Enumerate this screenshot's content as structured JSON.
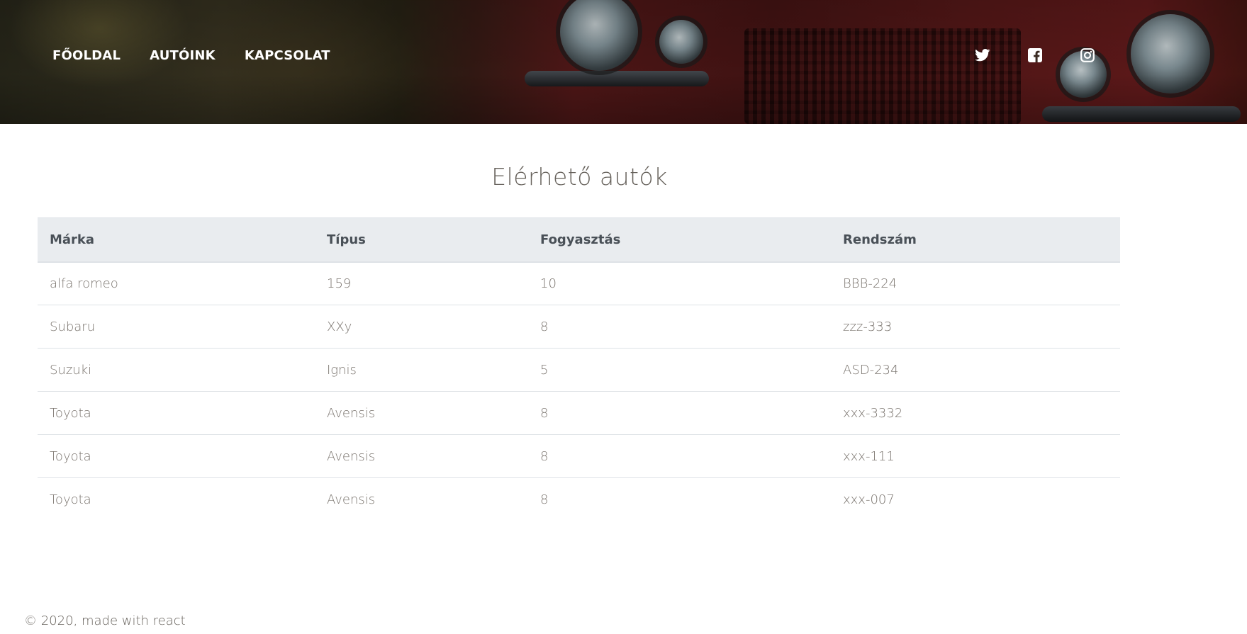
{
  "nav": {
    "items": [
      {
        "label": "FŐOLDAL"
      },
      {
        "label": "AUTÓINK"
      },
      {
        "label": "KAPCSOLAT"
      }
    ]
  },
  "social": {
    "icons": [
      "twitter-icon",
      "facebook-icon",
      "instagram-icon"
    ]
  },
  "main": {
    "title": "Elérhető autók",
    "table": {
      "headers": [
        "Márka",
        "Típus",
        "Fogyasztás",
        "Rendszám"
      ],
      "rows": [
        [
          "alfa romeo",
          "159",
          "10",
          "BBB-224"
        ],
        [
          "Subaru",
          "XXy",
          "8",
          "zzz-333"
        ],
        [
          "Suzuki",
          "Ignis",
          "5",
          "ASD-234"
        ],
        [
          "Toyota",
          "Avensis",
          "8",
          "xxx-3332"
        ],
        [
          "Toyota",
          "Avensis",
          "8",
          "xxx-111"
        ],
        [
          "Toyota",
          "Avensis",
          "8",
          "xxx-007"
        ]
      ]
    }
  },
  "footer": {
    "text": "© 2020, made with react"
  },
  "colors": {
    "text": "#66615b",
    "header_bg": "#e9ecef",
    "header_text": "#495057",
    "border": "#dee2e6"
  }
}
